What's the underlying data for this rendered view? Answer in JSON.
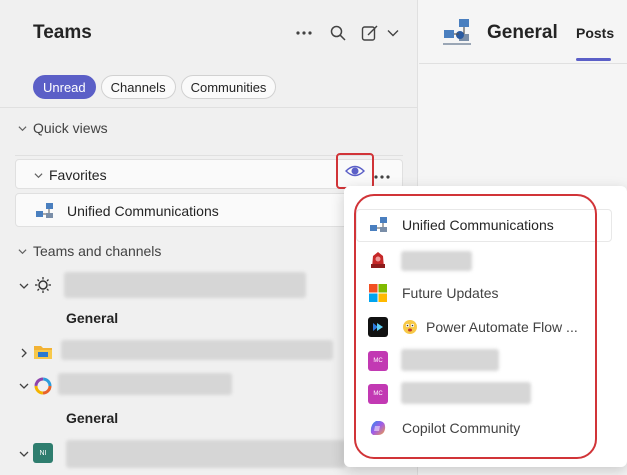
{
  "sidebar": {
    "title": "Teams",
    "filters": [
      {
        "label": "Unread",
        "active": true
      },
      {
        "label": "Channels",
        "active": false
      },
      {
        "label": "Communities",
        "active": false
      }
    ],
    "quick_views_label": "Quick views",
    "favorites_label": "Favorites",
    "favorite_item": "Unified Communications",
    "teams_and_channels_label": "Teams and channels",
    "general_label_1": "General",
    "general_label_2": "General",
    "team_avatar_initials": "NI"
  },
  "channel": {
    "title": "General",
    "tab_posts": "Posts"
  },
  "popup": {
    "items": [
      {
        "label": "Unified Communications",
        "icon": "network-team-icon"
      },
      {
        "label": "",
        "icon": "red-team-icon"
      },
      {
        "label": "Future Updates",
        "icon": "windows-logo-icon"
      },
      {
        "label": "Power Automate Flow ...",
        "icon": "power-automate-icon"
      },
      {
        "label": "",
        "icon": "mc-avatar-icon"
      },
      {
        "label": "",
        "icon": "mc-avatar-icon"
      },
      {
        "label": "Copilot Community",
        "icon": "copilot-icon"
      }
    ],
    "mc_initials": "MC"
  },
  "colors": {
    "accent": "#5b5fc7",
    "highlight_red": "#d13438",
    "mc_magenta": "#c239b3"
  }
}
